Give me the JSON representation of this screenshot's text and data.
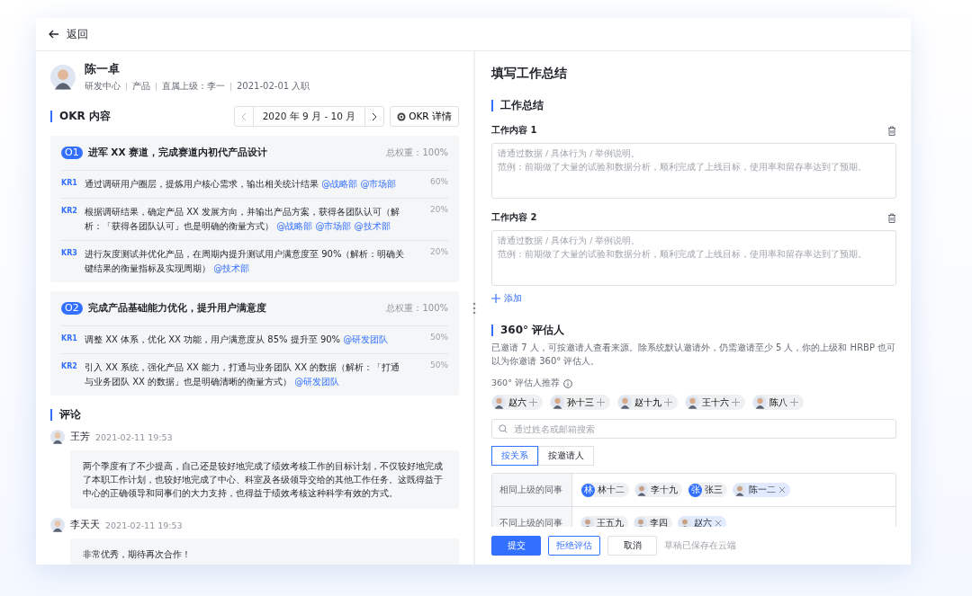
{
  "header": {
    "back_label": "返回"
  },
  "profile": {
    "name": "陈一卓",
    "meta": [
      "研发中心",
      "产品",
      "直属上级：李一",
      "2021-02-01 入职"
    ]
  },
  "okr": {
    "title": "OKR 内容",
    "period": "2020 年 9 月 - 10 月",
    "detail_button": "OKR 详情",
    "objectives": [
      {
        "badge": "O1",
        "title": "进军 XX 赛道，完成赛道内初代产品设计",
        "weight": "总权重：100%",
        "key_results": [
          {
            "badge": "KR1",
            "text": "通过调研用户圈层，提炼用户核心需求，输出相关统计结果",
            "mentions": [
              "@战略部",
              "@市场部"
            ],
            "weight": "60%"
          },
          {
            "badge": "KR2",
            "text": "根据调研结果，确定产品 XX 发展方向，并输出产品方案，获得各团队认可（解析：「获得各团队认可」也是明确的衡量方式）",
            "mentions": [
              "@战略部",
              "@市场部",
              "@技术部"
            ],
            "weight": "20%"
          },
          {
            "badge": "KR3",
            "text": "进行灰度测试并优化产品，在周期内提升测试用户满意度至 90%（解析：明确关键结果的衡量指标及实现周期）",
            "mentions": [
              "@技术部"
            ],
            "weight": "20%"
          }
        ]
      },
      {
        "badge": "O2",
        "title": "完成产品基础能力优化，提升用户满意度",
        "weight": "总权重：100%",
        "key_results": [
          {
            "badge": "KR1",
            "text": "调整 XX 体系，优化 XX 功能，用户满意度从 85% 提升至 90%",
            "mentions": [
              "@研发团队"
            ],
            "weight": "50%"
          },
          {
            "badge": "KR2",
            "text": "引入 XX 系统，强化产品 XX 能力，打通与业务团队 XX 的数据（解析：「打通与业务团队 XX 的数据」也是明确清晰的衡量方式）",
            "mentions": [
              "@研发团队"
            ],
            "weight": "50%"
          }
        ]
      }
    ]
  },
  "comments": {
    "title": "评论",
    "items": [
      {
        "author": "王芳",
        "time": "2021-02-11 19:53",
        "text": "两个季度有了不少提高，自己还是较好地完成了绩效考核工作的目标计划，不仅较好地完成了本职工作计划，也较好地完成了中心、科室及各级领导交给的其他工作任务。这既得益于中心的正确领导和同事们的大力支持，也得益于绩效考核这种科学有效的方式。"
      },
      {
        "author": "李天天",
        "time": "2021-02-11 19:53",
        "text": "非常优秀，期待再次合作！"
      }
    ]
  },
  "summary_form": {
    "title": "填写工作总结",
    "section_title": "工作总结",
    "items": [
      {
        "label": "工作内容 1",
        "placeholder": "请通过数据 / 具体行为 / 举例说明。",
        "example": "范例：前期做了大量的试验和数据分析，顺利完成了上线目标，使用率和留存率达到了预期。"
      },
      {
        "label": "工作内容 2",
        "placeholder": "请通过数据 / 具体行为 / 举例说明。",
        "example": "范例：前期做了大量的试验和数据分析，顺利完成了上线目标，使用率和留存率达到了预期。"
      }
    ],
    "add_label": "添加"
  },
  "evaluators": {
    "title": "360° 评估人",
    "description": "已邀请 7 人，可按邀请人查看来源。除系统默认邀请外，仍需邀请至少 5 人，你的上级和 HRBP 也可以为你邀请 360° 评估人。",
    "recommend_label": "360° 评估人推荐",
    "recommended": [
      {
        "name": "赵六"
      },
      {
        "name": "孙十三"
      },
      {
        "name": "赵十九"
      },
      {
        "name": "王十六"
      },
      {
        "name": "陈八"
      }
    ],
    "search": {
      "placeholder": "通过姓名或邮箱搜索"
    },
    "tabs": [
      {
        "label": "按关系",
        "selected": true
      },
      {
        "label": "按邀请人",
        "selected": false
      }
    ],
    "groups": [
      {
        "label": "相同上级的同事",
        "people": [
          {
            "name": "林十二",
            "avatar": {
              "kind": "letter",
              "text": "林"
            },
            "removable": false
          },
          {
            "name": "李十九",
            "avatar": {
              "kind": "photo"
            },
            "removable": false
          },
          {
            "name": "张三",
            "avatar": {
              "kind": "letter",
              "text": "张"
            },
            "removable": false
          },
          {
            "name": "陈一二",
            "avatar": {
              "kind": "photo"
            },
            "removable": true
          }
        ]
      },
      {
        "label": "不同上级的同事",
        "people": [
          {
            "name": "王五九",
            "avatar": {
              "kind": "photo"
            },
            "removable": false
          },
          {
            "name": "李四",
            "avatar": {
              "kind": "photo"
            },
            "removable": false
          },
          {
            "name": "赵六",
            "avatar": {
              "kind": "photo"
            },
            "removable": true
          }
        ]
      }
    ]
  },
  "footer": {
    "buttons": [
      {
        "label": "提交",
        "kind": "primary"
      },
      {
        "label": "拒绝评估",
        "kind": "outline"
      },
      {
        "label": "取消",
        "kind": "default"
      }
    ],
    "status": "草稿已保存在云端"
  }
}
